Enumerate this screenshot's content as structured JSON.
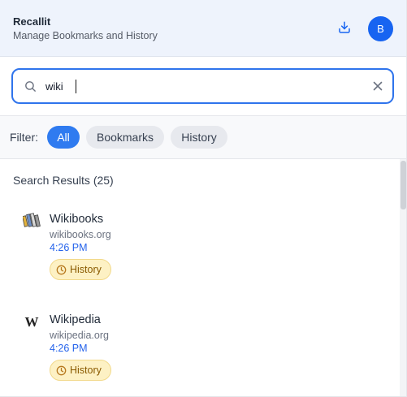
{
  "header": {
    "title": "Recallit",
    "subtitle": "Manage Bookmarks and History",
    "download_icon": "download-icon",
    "avatar_letter": "B",
    "accent_color": "#1764f1"
  },
  "search": {
    "value": "wiki",
    "placeholder": "",
    "search_icon": "search-icon",
    "clear_icon": "close-icon"
  },
  "filter": {
    "label": "Filter:",
    "options": [
      "All",
      "Bookmarks",
      "History"
    ],
    "selected": "All"
  },
  "results": {
    "heading": "Search Results (25)",
    "items": [
      {
        "title": "Wikibooks",
        "domain": "wikibooks.org",
        "time": "4:26 PM",
        "badge": "History",
        "icon": "wikibooks-favicon"
      },
      {
        "title": "Wikipedia",
        "domain": "wikipedia.org",
        "time": "4:26 PM",
        "badge": "History",
        "icon": "wikipedia-favicon"
      }
    ]
  },
  "colors": {
    "primary": "#2f7bf0",
    "link_time": "#2563eb",
    "badge_bg": "#fdf1c4",
    "badge_text": "#8a5a00"
  }
}
